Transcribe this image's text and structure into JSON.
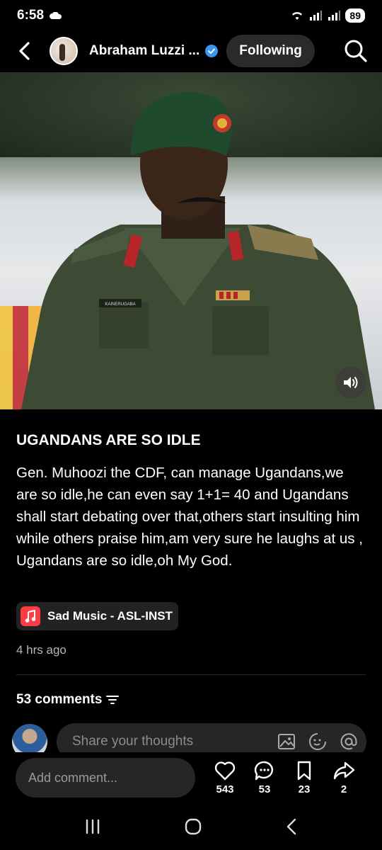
{
  "status_bar": {
    "time": "6:58",
    "battery": "89"
  },
  "header": {
    "username": "Abraham Luzzi ...",
    "follow_label": "Following"
  },
  "post": {
    "title": "UGANDANS ARE SO IDLE",
    "body": "Gen. Muhoozi the CDF, can manage Ugandans,we are so idle,he can even say 1+1= 40 and Ugandans shall start debating over that,others start insulting him while others praise him,am very sure he laughs at us , Ugandans are so idle,oh My God.",
    "music": "Sad Music - ASL-INST",
    "time_ago": "4 hrs ago",
    "badge_name": "KAINERUGABA"
  },
  "comments": {
    "count_label": "53 comments",
    "share_placeholder": "Share your thoughts"
  },
  "action_bar": {
    "add_comment_placeholder": "Add comment...",
    "likes": "543",
    "comments": "53",
    "saves": "23",
    "shares": "2"
  },
  "colors": {
    "background": "#000000",
    "chip": "#222222",
    "field": "#262626",
    "music_red": "#fc3c44",
    "verified_blue": "#3897f0"
  },
  "icons": [
    "back-icon",
    "verified-icon",
    "search-icon",
    "sound-icon",
    "music-note-icon",
    "sort-icon",
    "image-icon",
    "sticker-icon",
    "mention-icon",
    "heart-icon",
    "comment-icon",
    "bookmark-icon",
    "share-icon",
    "recents-icon",
    "home-icon",
    "back-nav-icon"
  ]
}
